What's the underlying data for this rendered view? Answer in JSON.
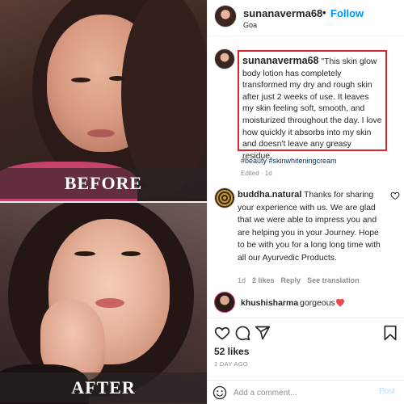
{
  "media": {
    "before_label": "BEFORE",
    "after_label": "AFTER"
  },
  "header": {
    "username": "sunanaverma68",
    "separator": "•",
    "follow_label": "Follow",
    "location": "Goa"
  },
  "caption": {
    "username": "sunanaverma68",
    "text": "\"This skin glow body lotion has completely transformed my dry and rough skin after just 2 weeks of use. It leaves my skin feeling soft, smooth, and moisturized throughout the day. I love how quickly it absorbs into my skin and doesn't leave any greasy residue.",
    "hashtags": "#beauty #skinwhiteningcream",
    "edited": "Edited · 1d"
  },
  "comments": [
    {
      "username": "buddha.natural",
      "text": "Thanks for sharing your experience with us. We are glad that we were able to impress you and are helping you in your Journey. Hope to be with you for a long long time with all our Ayurvedic Products.",
      "age": "1d",
      "likes": "2 likes",
      "reply": "Reply",
      "translation": "See translation"
    },
    {
      "username": "khushisharma",
      "text": "gorgeous",
      "emoji_icon": "red-heart-icon"
    }
  ],
  "actions": {
    "icons": [
      "heart-icon",
      "comment-icon",
      "share-icon",
      "bookmark-icon"
    ],
    "likes": "52 likes",
    "time_ago": "1 DAY AGO"
  },
  "add_comment": {
    "placeholder": "Add a comment...",
    "post_label": "Post"
  },
  "colors": {
    "follow": "#0095f6",
    "highlight_box": "#d9262e",
    "heart": "#ed4956",
    "post_disabled": "#b2dffc"
  }
}
